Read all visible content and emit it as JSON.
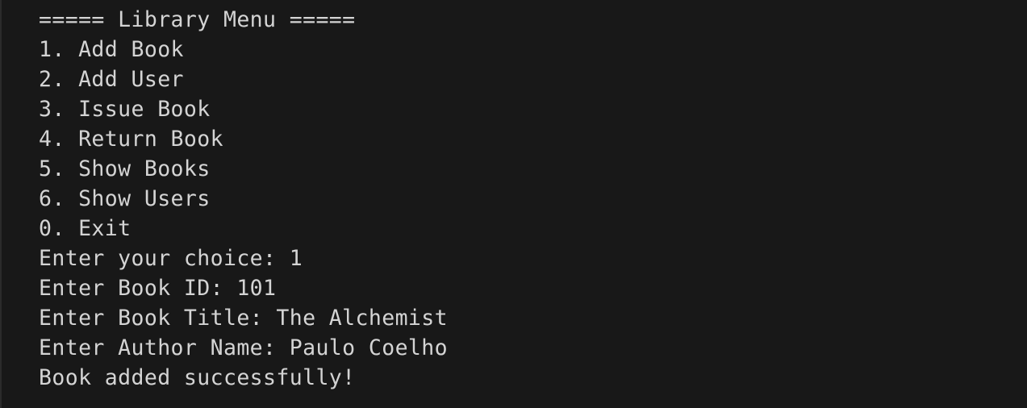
{
  "terminal": {
    "lines": [
      "===== Library Menu =====",
      "1. Add Book",
      "2. Add User",
      "3. Issue Book",
      "4. Return Book",
      "5. Show Books",
      "6. Show Users",
      "0. Exit",
      "Enter your choice: 1",
      "Enter Book ID: 101",
      "Enter Book Title: The Alchemist",
      "Enter Author Name: Paulo Coelho",
      "Book added successfully!"
    ]
  },
  "colors": {
    "background": "#181818",
    "text": "#d4d4d4"
  }
}
